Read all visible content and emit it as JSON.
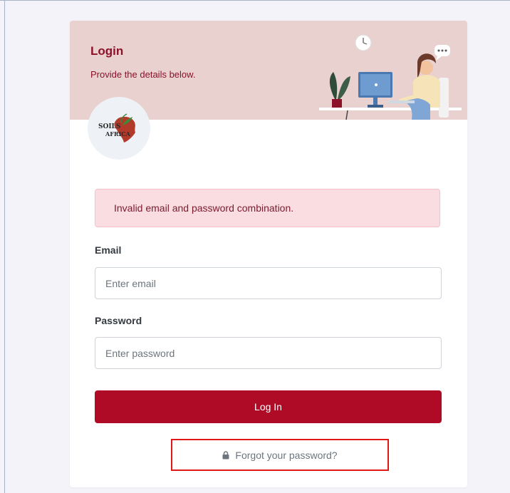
{
  "banner": {
    "title": "Login",
    "subtitle": "Provide the details below."
  },
  "logo": {
    "text_line1": "SOILS",
    "text_line2": "AFRICA"
  },
  "alert": {
    "message": "Invalid email and password combination."
  },
  "form": {
    "email_label": "Email",
    "email_placeholder": "Enter email",
    "password_label": "Password",
    "password_placeholder": "Enter password",
    "submit_label": "Log In"
  },
  "forgot": {
    "label": "Forgot your password?",
    "icon": "lock-icon"
  },
  "colors": {
    "brand": "#b00b26",
    "banner_bg": "#e8d1cf",
    "alert_bg": "#f9dde0",
    "highlight_border": "#e01717"
  }
}
